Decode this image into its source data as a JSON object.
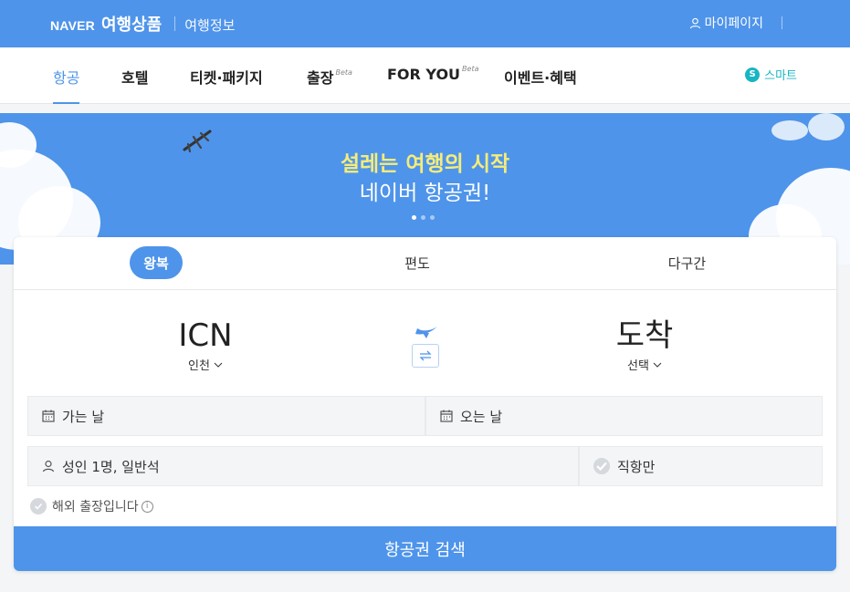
{
  "header": {
    "naver": "NAVER",
    "product": "여행상품",
    "travel_info": "여행정보",
    "mypage": "마이페이지"
  },
  "nav": {
    "items": [
      {
        "label": "항공"
      },
      {
        "label": "호텔"
      },
      {
        "label": "티켓·패키지"
      },
      {
        "label": "출장",
        "badge": "Beta"
      },
      {
        "label": "FOR YOU",
        "badge": "Beta"
      },
      {
        "label": "이벤트·혜택"
      }
    ],
    "smart_icon": "S",
    "smart": "스마트"
  },
  "banner": {
    "title": "설레는 여행의 시작",
    "subtitle": "네이버 항공권!",
    "page_count": 3,
    "active_page": 1
  },
  "search": {
    "tabs": [
      {
        "label": "왕복"
      },
      {
        "label": "편도"
      },
      {
        "label": "다구간"
      }
    ],
    "origin": {
      "code": "ICN",
      "city": "인천"
    },
    "destination": {
      "code": "도착",
      "city": "선택"
    },
    "depart_label": "가는 날",
    "return_label": "오는 날",
    "passengers": "성인 1명, 일반석",
    "direct_only": "직항만",
    "business_trip": "해외 출장입니다",
    "info_icon": "i",
    "button": "항공권 검색"
  },
  "colors": {
    "brand_blue": "#4e94ea",
    "banner_title": "#f5ec7a",
    "smart_teal": "#18b5c2"
  }
}
